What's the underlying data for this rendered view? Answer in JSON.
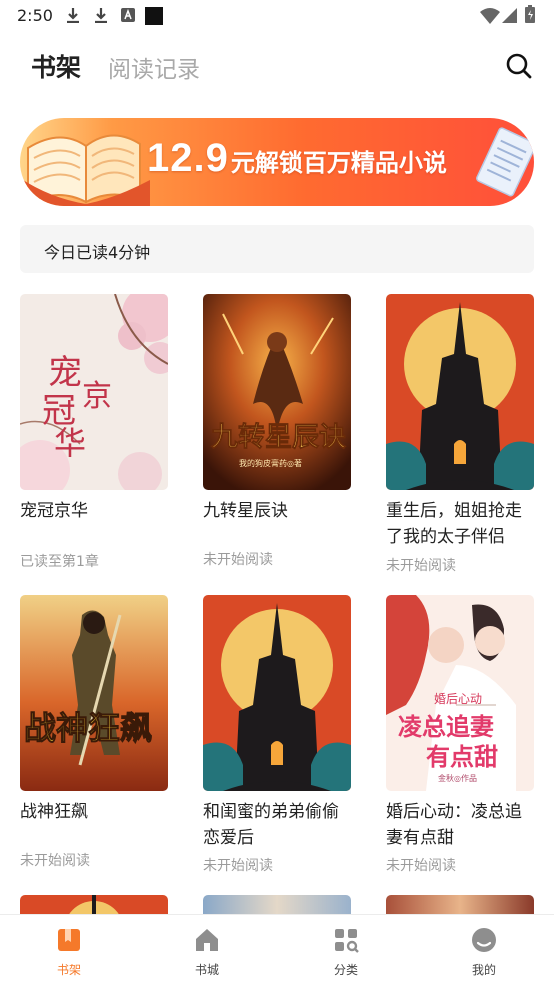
{
  "status_bar": {
    "time": "2:50"
  },
  "header": {
    "tabs": [
      {
        "label": "书架",
        "active": true
      },
      {
        "label": "阅读记录",
        "active": false
      }
    ]
  },
  "banner": {
    "price": "12.9",
    "text": "元解锁百万精品小说"
  },
  "today": {
    "text": "今日已读4分钟"
  },
  "books": [
    {
      "title": "宠冠京华",
      "status": "已读至第1章",
      "cover_text": "宠冠京华"
    },
    {
      "title": "九转星辰诀",
      "status": "未开始阅读",
      "cover_text": "九转星辰诀",
      "cover_author": "我的狗皮膏药◎著"
    },
    {
      "title": "重生后，姐姐抢走了我的太子伴侣",
      "status": "未开始阅读"
    },
    {
      "title": "战神狂飙",
      "status": "未开始阅读",
      "cover_text": "战神狂飙"
    },
    {
      "title": "和闺蜜的弟弟偷偷恋爱后",
      "status": "未开始阅读"
    },
    {
      "title": "婚后心动：凌总追妻有点甜",
      "status": "未开始阅读",
      "cover_text": "凌总追妻有点甜",
      "cover_small": "婚后心动",
      "cover_author": "金秋◎作品"
    }
  ],
  "nav": [
    {
      "label": "书架",
      "icon": "bookshelf-icon",
      "active": true
    },
    {
      "label": "书城",
      "icon": "home-icon",
      "active": false
    },
    {
      "label": "分类",
      "icon": "category-icon",
      "active": false
    },
    {
      "label": "我的",
      "icon": "profile-icon",
      "active": false
    }
  ],
  "colors": {
    "accent": "#f5792a",
    "inactive_tab": "#a9a9a9",
    "muted_text": "#9b9b9b"
  }
}
